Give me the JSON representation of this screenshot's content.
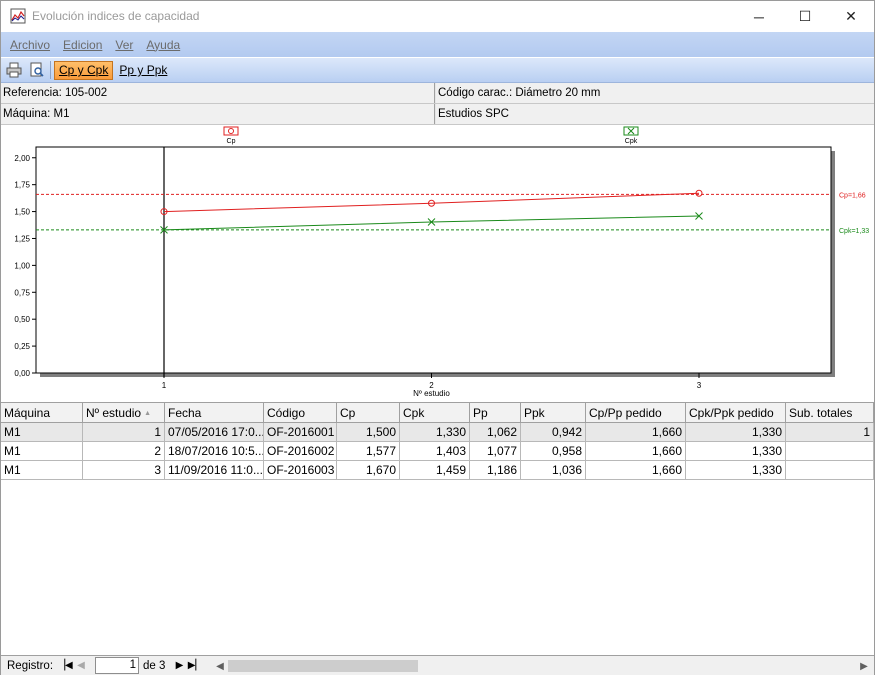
{
  "window": {
    "title": "Evolución indices de capacidad",
    "minimize_glyph": "─",
    "maximize_glyph": "☐",
    "close_glyph": "✕"
  },
  "menu": {
    "items": [
      {
        "label": "Archivo"
      },
      {
        "label": "Edicion"
      },
      {
        "label": "Ver"
      },
      {
        "label": "Ayuda"
      }
    ]
  },
  "toolbar": {
    "print_icon": "printer-icon",
    "preview_icon": "print-preview-icon",
    "buttons": [
      {
        "label": "Cp y Cpk",
        "active": true
      },
      {
        "label": "Pp y Ppk",
        "active": false
      }
    ]
  },
  "info": {
    "referencia": "Referencia: 105-002",
    "codigo_carac": "Código carac.: Diámetro 20 mm",
    "maquina": "Máquina: M1",
    "estudios": "Estudios SPC"
  },
  "chart_data": {
    "type": "line",
    "xlabel": "Nº estudio",
    "ylabel": "",
    "x": [
      1,
      2,
      3
    ],
    "xlim": [
      1,
      3
    ],
    "ylim": [
      0,
      2.1
    ],
    "yticks": [
      "0,00",
      "0,25",
      "0,50",
      "0,75",
      "1,00",
      "1,25",
      "1,50",
      "1,75",
      "2,00"
    ],
    "xticks": [
      "1",
      "2",
      "3"
    ],
    "legend_placement": "top",
    "series": [
      {
        "name": "Cp",
        "values": [
          1.5,
          1.577,
          1.67
        ],
        "color": "#e02020",
        "marker": "circle"
      },
      {
        "name": "Cpk",
        "values": [
          1.33,
          1.403,
          1.459
        ],
        "color": "#1a8a1a",
        "marker": "x"
      }
    ],
    "reference_lines": [
      {
        "label": "Cp=1,66",
        "value": 1.66,
        "color": "#e02020"
      },
      {
        "label": "Cpk=1,33",
        "value": 1.33,
        "color": "#1a8a1a"
      }
    ]
  },
  "grid": {
    "columns": [
      "Máquina",
      "Nº estudio",
      "Fecha",
      "Código",
      "Cp",
      "Cpk",
      "Pp",
      "Ppk",
      "Cp/Pp pedido",
      "Cpk/Ppk pedido",
      "Sub. totales"
    ],
    "sort_indicator": "▲",
    "rows": [
      [
        "M1",
        "1",
        "07/05/2016 17:0...",
        "OF-2016001",
        "1,500",
        "1,330",
        "1,062",
        "0,942",
        "1,660",
        "1,330",
        "1"
      ],
      [
        "M1",
        "2",
        "18/07/2016 10:5...",
        "OF-2016002",
        "1,577",
        "1,403",
        "1,077",
        "0,958",
        "1,660",
        "1,330",
        ""
      ],
      [
        "M1",
        "3",
        "11/09/2016 11:0...",
        "OF-2016003",
        "1,670",
        "1,459",
        "1,186",
        "1,036",
        "1,660",
        "1,330",
        ""
      ]
    ]
  },
  "navigator": {
    "label": "Registro:",
    "current": "1",
    "of_text": "de 3"
  }
}
